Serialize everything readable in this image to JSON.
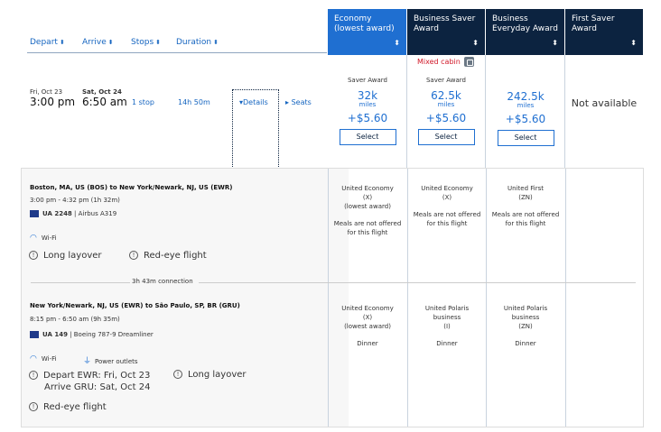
{
  "header": {
    "sort": [
      {
        "id": "depart",
        "label": "Depart",
        "arrow": "⬍"
      },
      {
        "id": "arrive",
        "label": "Arrive",
        "arrow": "⬍"
      },
      {
        "id": "stops",
        "label": "Stops",
        "arrow": "⬍"
      },
      {
        "id": "duration",
        "label": "Duration",
        "arrow": "⬍"
      }
    ],
    "cabins": [
      {
        "line1": "Economy",
        "line2": "(lowest award)",
        "chevron": "⬍"
      },
      {
        "line1": "Business Saver",
        "line2": "Award",
        "chevron": "⬍"
      },
      {
        "line1": "Business",
        "line2": "Everyday Award",
        "chevron": "⬍"
      },
      {
        "line1": "First Saver Award",
        "line2": "",
        "chevron": "⬍"
      }
    ]
  },
  "flight": {
    "mixed_cabin": "Mixed cabin",
    "depart_date": "Fri, Oct 23",
    "depart_time": "3:00 pm",
    "arrive_date": "Sat, Oct 24",
    "arrive_time": "6:50 am",
    "stops": "1 stop",
    "duration": "14h 50m",
    "details": "Details",
    "seats": "Seats",
    "prices": [
      {
        "label": "Saver Award",
        "miles": "32k",
        "miles_unit": "miles",
        "tax": "+$5.60",
        "button": "Select"
      },
      {
        "label": "Saver Award",
        "miles": "62.5k",
        "miles_unit": "miles",
        "tax": "+$5.60",
        "button": "Select"
      },
      {
        "label": "",
        "miles": "242.5k",
        "miles_unit": "miles",
        "tax": "+$5.60",
        "button": "Select"
      }
    ],
    "first_saver": "Not available"
  },
  "segments": [
    {
      "route": "Boston, MA, US (BOS) to New York/Newark, NJ, US (EWR)",
      "times": "3:00 pm - 4:32 pm (1h 32m)",
      "flight_no": "UA 2248",
      "aircraft": "| Airbus A319",
      "amenities": [
        "Wi-Fi"
      ],
      "warnings": [
        "Long layover",
        "Red-eye flight"
      ],
      "cabins": [
        {
          "lines": [
            "United Economy",
            "(X)",
            "(lowest award)"
          ],
          "meal": "Meals are not offered for this flight"
        },
        {
          "lines": [
            "United Economy",
            "(X)"
          ],
          "meal": "Meals are not offered for this flight"
        },
        {
          "lines": [
            "United First",
            "(ZN)"
          ],
          "meal": "Meals are not offered for this flight"
        }
      ]
    },
    {
      "route": "New York/Newark, NJ, US (EWR) to São Paulo, SP, BR (GRU)",
      "times": "8:15 pm - 6:50 am (9h 35m)",
      "flight_no": "UA 149",
      "aircraft": "| Boeing 787-9 Dreamliner",
      "amenities": [
        "Wi-Fi",
        "Power outlets"
      ],
      "warn_depart": "Depart EWR: Fri, Oct 23",
      "warn_arrive": "Arrive GRU: Sat, Oct 24",
      "warn_layover": "Long layover",
      "warn_redeye": "Red-eye flight",
      "cabins": [
        {
          "lines": [
            "United Economy",
            "(X)",
            "(lowest award)"
          ],
          "meal": "Dinner"
        },
        {
          "lines": [
            "United Polaris",
            "business",
            "(I)"
          ],
          "meal": "Dinner"
        },
        {
          "lines": [
            "United Polaris",
            "business",
            "(ZN)"
          ],
          "meal": "Dinner"
        }
      ]
    }
  ],
  "connection": "3h 43m connection",
  "colors": {
    "navy": "#0c2340",
    "accent": "#1f6fd1",
    "warning_red": "#d11a2a"
  },
  "icons": {
    "wifi": "wifi-icon",
    "power": "power-outlet-icon",
    "warning": "warning-icon",
    "flag": "airline-logo-icon"
  }
}
